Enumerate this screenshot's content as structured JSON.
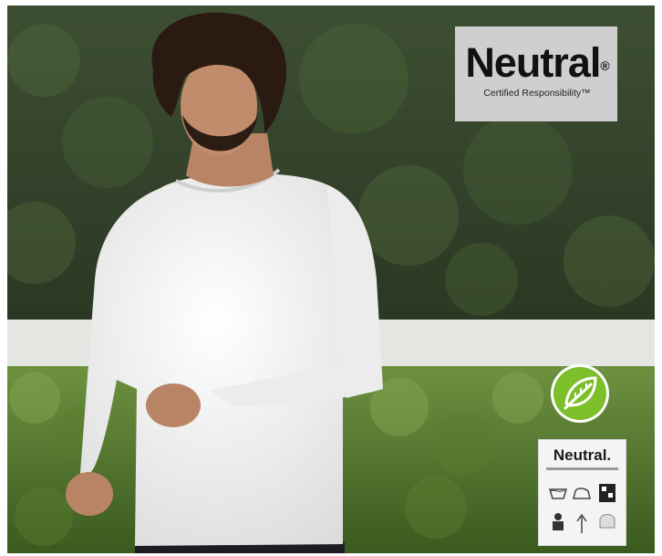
{
  "brand": {
    "name": "Neutral",
    "registered_mark": "®",
    "tagline": "Certified Responsibility™"
  },
  "label_card": {
    "brand": "Neutral."
  },
  "icons": {
    "eco": "leaf-icon",
    "care_symbols": [
      "wash-icon",
      "iron-icon",
      "certification-icon",
      "person-icon",
      "arrow-up-icon",
      "dry-icon"
    ]
  },
  "colors": {
    "eco_badge": "#7cbf2a",
    "logo_background": "#cfcfcf",
    "shirt": "#f2f2f2",
    "hedge": "#3f5f27"
  }
}
